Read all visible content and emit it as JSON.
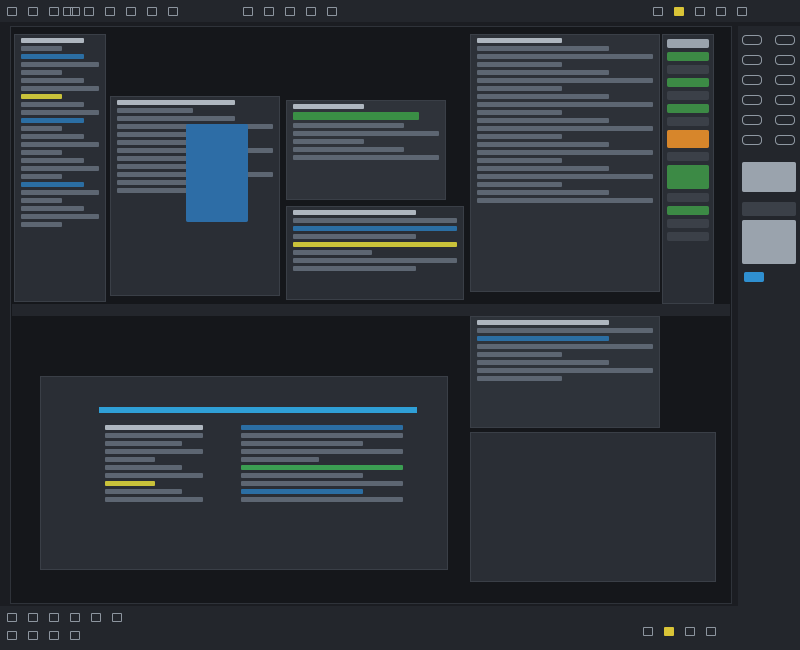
{
  "colors": {
    "background": "#1b1d22",
    "accent_blue": "#2d6da6",
    "accent_green": "#3a8f45",
    "accent_orange": "#e08a2d",
    "accent_cyan": "#2f9fd6",
    "accent_yellow": "#d9c437"
  },
  "top_toolbar": {
    "icons": [
      "menu-icon",
      "grid-icon",
      "layout-icon",
      "window-icon",
      "settings-icon",
      "folder-icon",
      "search-icon",
      "share-icon"
    ]
  },
  "workspace": {
    "panels": [
      "left-sidebar-panel",
      "center-upper-panel",
      "right-upper-panel",
      "lower-left-panel",
      "lower-right-panel"
    ]
  },
  "right_sidebar": {
    "icons": [
      "sliders-icon",
      "bookmark-icon",
      "layers-icon",
      "filter-icon",
      "link-icon",
      "refresh-icon",
      "gear-icon"
    ]
  },
  "bottom_toolbar": {
    "icons": [
      "play-icon",
      "stop-icon",
      "record-icon",
      "loop-icon",
      "zoom-icon",
      "export-icon"
    ]
  }
}
